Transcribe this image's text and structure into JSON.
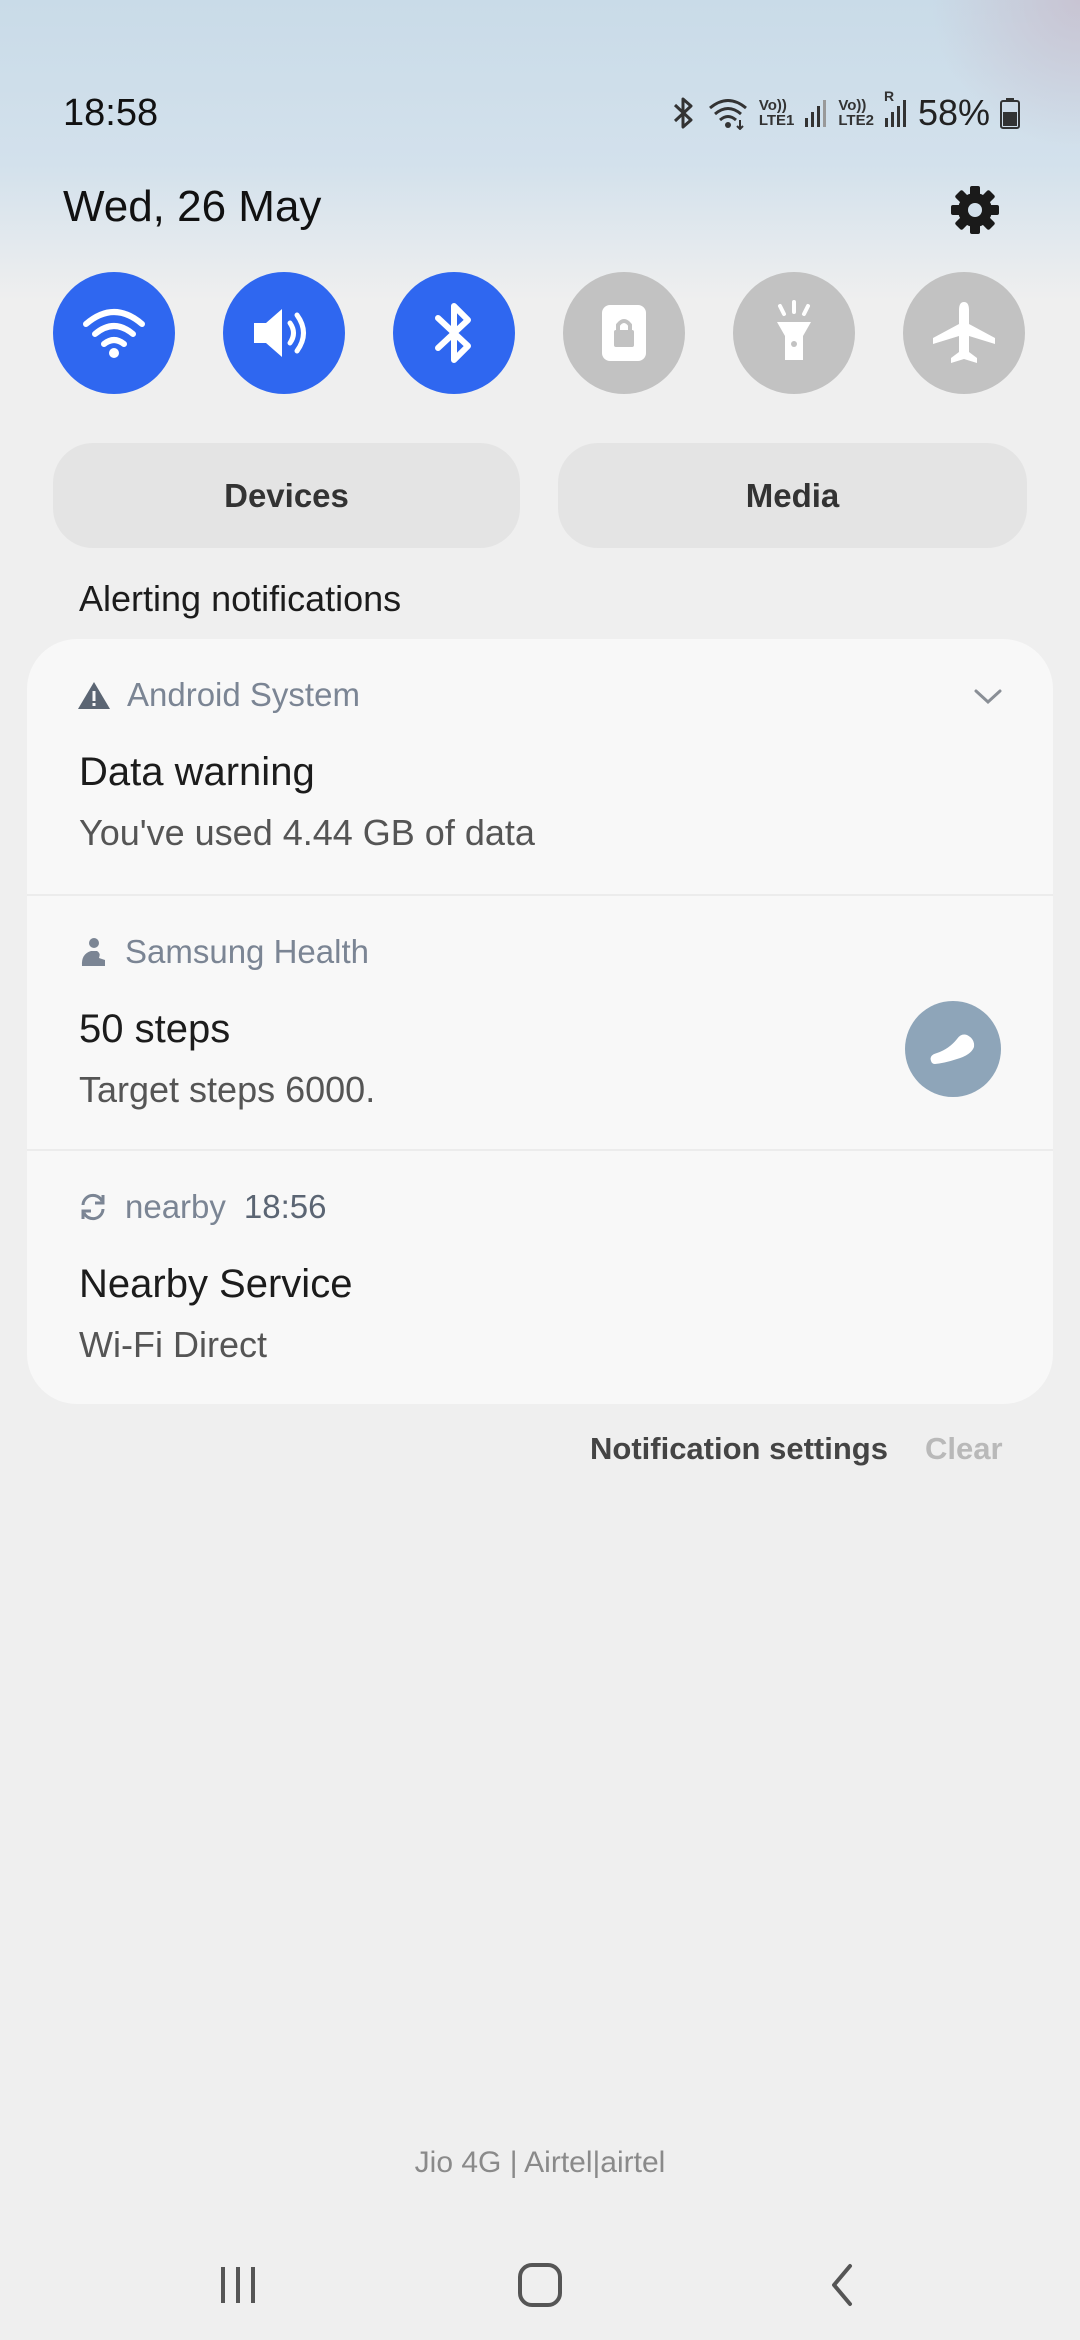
{
  "status_bar": {
    "time": "18:58",
    "battery_percent": "58%",
    "sim1_tag_top": "Vo))",
    "sim1_tag_bottom": "LTE1",
    "sim2_tag_top": "Vo))",
    "sim2_tag_bottom": "LTE2",
    "sim2_roaming": "R",
    "icons": [
      "bluetooth-icon",
      "wifi-icon",
      "signal-icon",
      "battery-icon"
    ]
  },
  "header": {
    "date": "Wed, 26 May",
    "settings_icon": "gear-icon"
  },
  "quick_toggles": [
    {
      "name": "wifi",
      "icon": "wifi-icon",
      "state": "on"
    },
    {
      "name": "sound",
      "icon": "speaker-icon",
      "state": "on"
    },
    {
      "name": "bluetooth",
      "icon": "bluetooth-icon",
      "state": "on"
    },
    {
      "name": "rotation-lock",
      "icon": "lock-icon",
      "state": "off"
    },
    {
      "name": "flashlight",
      "icon": "flashlight-icon",
      "state": "off"
    },
    {
      "name": "airplane-mode",
      "icon": "airplane-icon",
      "state": "off"
    }
  ],
  "panels": {
    "devices_label": "Devices",
    "media_label": "Media"
  },
  "notifications": {
    "section_label": "Alerting notifications",
    "items": [
      {
        "app": "Android System",
        "icon": "warning-icon",
        "title": "Data warning",
        "text": "You've used 4.44 GB of data"
      },
      {
        "app": "Samsung Health",
        "icon": "health-icon",
        "title": "50 steps",
        "text": "Target steps 6000."
      },
      {
        "app": "nearby",
        "time": "18:56",
        "icon": "sync-icon",
        "title": "Nearby Service",
        "text": "Wi-Fi Direct"
      }
    ],
    "settings_label": "Notification settings",
    "clear_label": "Clear"
  },
  "carrier_text": "Jio 4G | Airtel|airtel",
  "nav": [
    "recents-icon",
    "home-icon",
    "back-icon"
  ],
  "colors": {
    "toggle_on": "#2f67f0",
    "toggle_off": "#c2c2c2",
    "app_name": "#7b8594",
    "health_badge": "#8ea5b9"
  }
}
